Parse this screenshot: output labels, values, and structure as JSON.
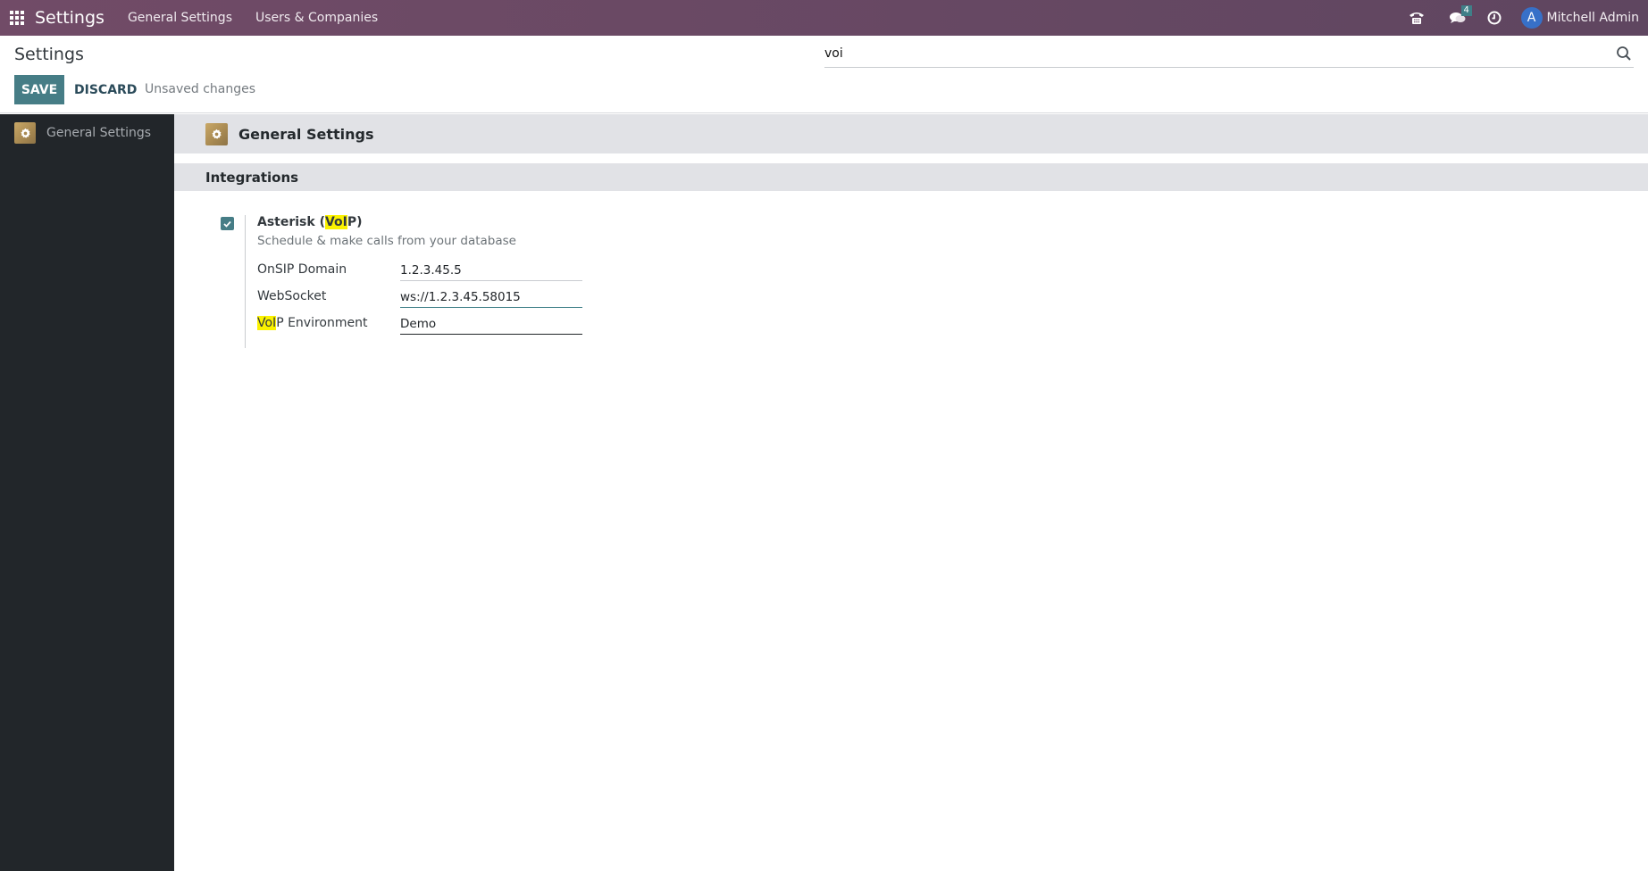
{
  "navbar": {
    "app_name": "Settings",
    "menus": [
      "General Settings",
      "Users & Companies"
    ],
    "icons": [
      "apps-grid-icon",
      "phone-icon",
      "chat-icon",
      "clock-icon"
    ],
    "chat_badge_count": "4",
    "user": {
      "initial": "A",
      "name": "Mitchell Admin",
      "avatar_color": "#3770c8"
    },
    "bar_color": "#714b67"
  },
  "control_panel": {
    "title": "Settings",
    "save_label": "SAVE",
    "discard_label": "DISCARD",
    "status_text": "Unsaved changes",
    "search": {
      "value": "voi",
      "placeholder": "Search..."
    }
  },
  "sidebar": {
    "items": [
      {
        "label": "General Settings",
        "icon": "gear-icon"
      }
    ]
  },
  "main": {
    "app_title": "General Settings",
    "sections": [
      {
        "title": "Integrations",
        "settings": [
          {
            "name_before": "Asterisk (",
            "name_highlight": "VoI",
            "name_after": "P)",
            "description": "Schedule & make calls from your database",
            "checked": true,
            "fields": [
              {
                "label": "OnSIP Domain",
                "value": "1.2.3.45.5"
              },
              {
                "label": "WebSocket",
                "value": "ws://1.2.3.45.58015"
              },
              {
                "label_highlight": "VoI",
                "label_after": "P Environment",
                "value": "Demo"
              }
            ]
          }
        ]
      }
    ]
  },
  "colors": {
    "primary": "#467d86",
    "highlight": "#fbf200",
    "sidebar_bg": "#22262a",
    "section_bg": "#e1e2e6"
  }
}
